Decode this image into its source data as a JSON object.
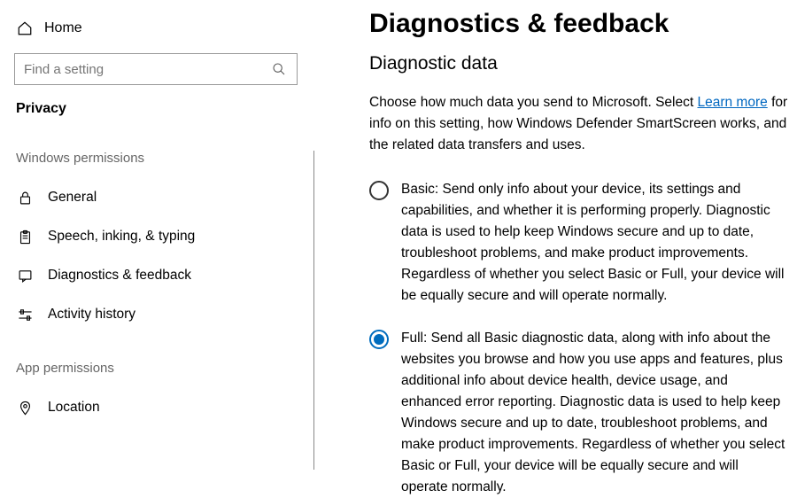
{
  "sidebar": {
    "home_label": "Home",
    "search_placeholder": "Find a setting",
    "category_label": "Privacy",
    "group1_label": "Windows permissions",
    "items": {
      "general": "General",
      "speech": "Speech, inking, & typing",
      "diagnostics": "Diagnostics & feedback",
      "activity": "Activity history"
    },
    "group2_label": "App permissions",
    "items2": {
      "location": "Location"
    }
  },
  "page": {
    "title": "Diagnostics & feedback",
    "section": "Diagnostic data",
    "intro_before": "Choose how much data you send to Microsoft. Select ",
    "learn_more": "Learn more",
    "intro_after": " for info on this setting, how Windows Defender SmartScreen works, and the related data transfers and uses.",
    "options": {
      "basic": "Basic: Send only info about your device, its settings and capabilities, and whether it is performing properly. Diagnostic data is used to help keep Windows secure and up to date, troubleshoot problems, and make product improvements. Regardless of whether you select Basic or Full, your device will be equally secure and will operate normally.",
      "full": "Full: Send all Basic diagnostic data, along with info about the websites you browse and how you use apps and features, plus additional info about device health, device usage, and enhanced error reporting. Diagnostic data is used to help keep Windows secure and up to date, troubleshoot problems, and make product improvements. Regardless of whether you select Basic or Full, your device will be equally secure and will operate normally."
    }
  }
}
